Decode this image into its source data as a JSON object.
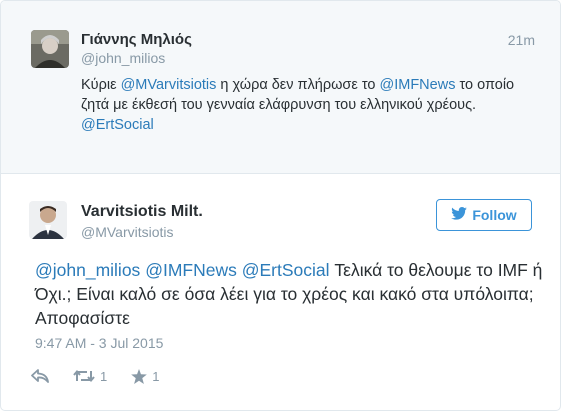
{
  "quoted_tweet": {
    "name": "Γιάννης Μηλιός",
    "handle": "@john_milios",
    "time": "21m",
    "text_parts": [
      "Κύριε ",
      "@MVarvitsiotis",
      " η χώρα δεν πλήρωσε το ",
      "@IMFNews",
      " το οποίο ζητά με έκθεσή του γενναία ελάφρυνση του ελληνικού χρέους.",
      "@ErtSocial"
    ]
  },
  "main_tweet": {
    "name": "Varvitsiotis Milt.",
    "handle": "@MVarvitsiotis",
    "follow_label": "Follow",
    "text_parts": [
      "@john_milios",
      " ",
      "@IMFNews",
      " ",
      "@ErtSocial",
      " Τελικά το θελουμε το IMF ή Όχι.; Είναι καλό σε όσα λέει για το χρέος και κακό στα υπόλοιπα; Αποφασίστε"
    ],
    "date": "9:47 AM - 3 Jul 2015",
    "retweet_count": "1",
    "favorite_count": "1"
  },
  "colors": {
    "link": "#2b7bb9",
    "follow_blue": "#3b94d9",
    "muted": "#8899a6",
    "text": "#292f33"
  },
  "icons": [
    "reply-icon",
    "retweet-icon",
    "favorite-star-icon",
    "twitter-bird-icon"
  ]
}
